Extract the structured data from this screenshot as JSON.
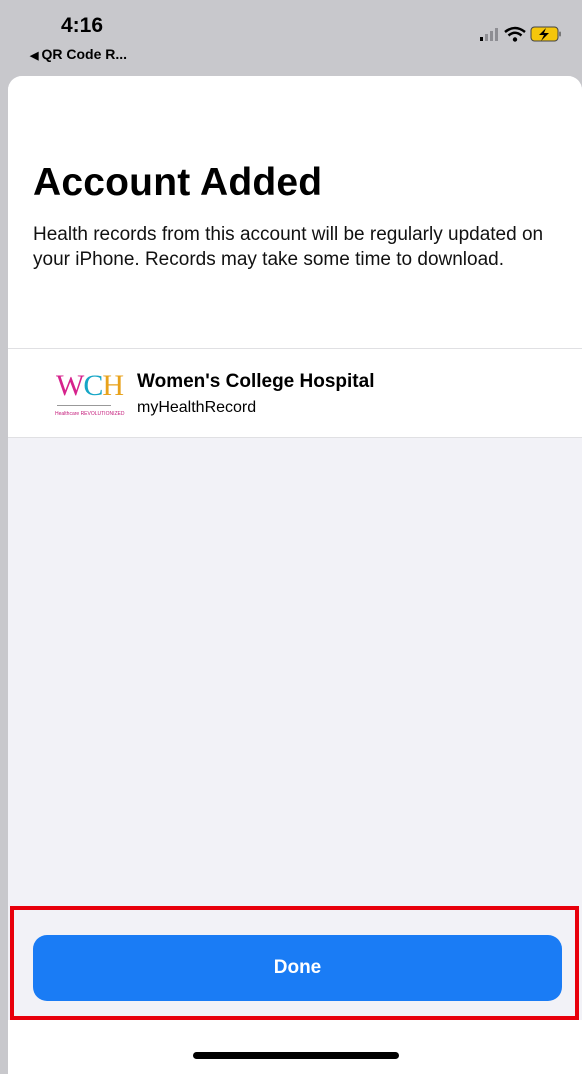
{
  "status_bar": {
    "time": "4:16",
    "back_app": "QR Code R...",
    "back_icon": "back-triangle-icon",
    "icons": [
      "cellular-signal-icon",
      "wifi-icon",
      "battery-charging-icon"
    ]
  },
  "sheet": {
    "title": "Account Added",
    "description": "Health records from this account will be regularly updated on your iPhone. Records may take some time to download."
  },
  "account": {
    "name": "Women's College Hospital",
    "subtitle": "myHealthRecord",
    "logo": {
      "letters_w": "W",
      "letters_c": "C",
      "letters_h": "H",
      "subtext": "Healthcare REVOLUTIONIZED"
    }
  },
  "actions": {
    "done_label": "Done"
  },
  "colors": {
    "accent": "#1a7cf5",
    "highlight": "#e8000b",
    "sheet_bg": "#f2f2f7",
    "status_bg": "#c8c8cc"
  }
}
